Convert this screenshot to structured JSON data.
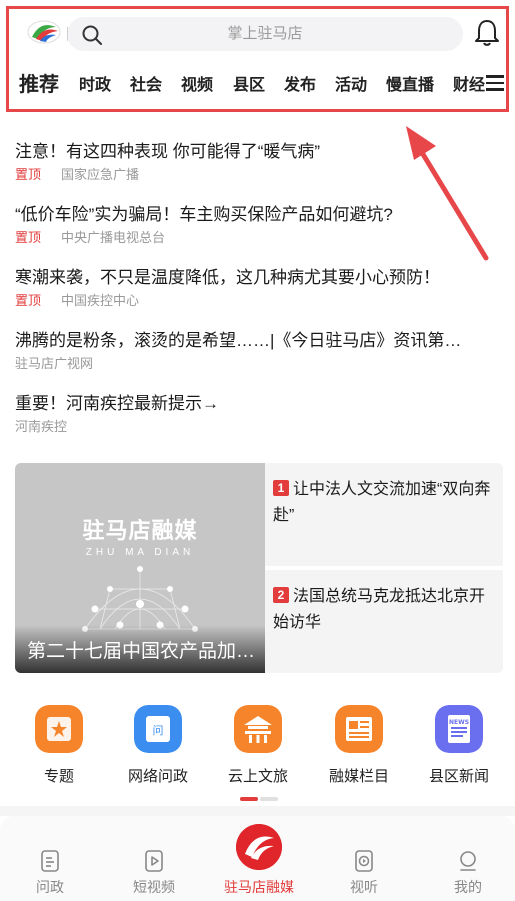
{
  "header": {
    "search_placeholder": "掌上驻马店",
    "channels": [
      "推荐",
      "时政",
      "社会",
      "视频",
      "县区",
      "发布",
      "活动",
      "慢直播",
      "财经"
    ]
  },
  "news": [
    {
      "title": "注意！有这四种表现 你可能得了“暖气病”",
      "pin": "置顶",
      "source": "国家应急广播"
    },
    {
      "title": "“低价车险”实为骗局！车主购买保险产品如何避坑?",
      "pin": "置顶",
      "source": "中央广播电视总台"
    },
    {
      "title": "寒潮来袭，不只是温度降低，这几种病尤其要小心预防！",
      "pin": "置顶",
      "source": "中国疾控中心"
    },
    {
      "title": "沸腾的是粉条，滚烫的是希望……|《今日驻马店》资讯第…",
      "pin": "",
      "source": "驻马店广视网"
    },
    {
      "title": "重要！河南疾控最新提示→",
      "pin": "",
      "source": "河南疾控"
    }
  ],
  "featured": {
    "brand": "驻马店融媒",
    "brand_sub": "ZHU MA DIAN",
    "caption": "第二十七届中国农产品加…",
    "side": [
      {
        "num": "1",
        "text": "让中法人文交流加速“双向奔赴”"
      },
      {
        "num": "2",
        "text": "法国总统马克龙抵达北京开始访华"
      }
    ]
  },
  "quick_links": [
    {
      "label": "专题",
      "icon": "topic-icon",
      "color": "#f5842a"
    },
    {
      "label": "网络问政",
      "icon": "inquiry-icon",
      "color": "#3b8ef0"
    },
    {
      "label": "云上文旅",
      "icon": "temple-icon",
      "color": "#f5842a"
    },
    {
      "label": "融媒栏目",
      "icon": "newspaper-icon",
      "color": "#f5842a"
    },
    {
      "label": "县区新闻",
      "icon": "news-icon",
      "color": "#6a6ff0"
    }
  ],
  "bottom_nav": [
    {
      "label": "问政",
      "icon": "document-icon"
    },
    {
      "label": "短视频",
      "icon": "play-icon"
    },
    {
      "label": "驻马店融媒",
      "icon": "logo-icon"
    },
    {
      "label": "视听",
      "icon": "video-icon"
    },
    {
      "label": "我的",
      "icon": "profile-icon"
    }
  ],
  "colors": {
    "accent": "#e23c3c",
    "annotation": "#e8474a"
  }
}
